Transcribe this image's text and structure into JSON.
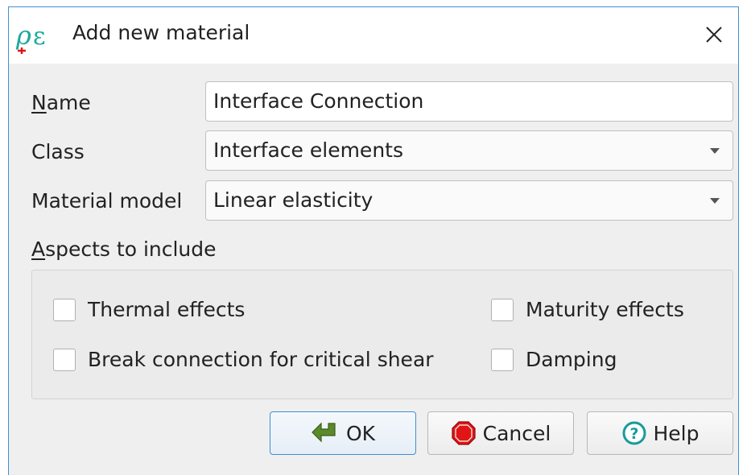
{
  "window": {
    "title": "Add new material",
    "app_icon": "oe-logo-icon",
    "close_icon": "close-icon"
  },
  "form": {
    "name": {
      "label_accel": "N",
      "label_rest": "ame",
      "value": "Interface Connection"
    },
    "class": {
      "label": "Class",
      "value": "Interface elements"
    },
    "material_model": {
      "label": "Material model",
      "value": "Linear elasticity"
    }
  },
  "aspects": {
    "label_accel": "A",
    "label_rest": "spects to include",
    "items": [
      {
        "label": "Thermal effects",
        "checked": false
      },
      {
        "label": "Maturity effects",
        "checked": false
      },
      {
        "label": "Break connection for critical shear",
        "checked": false
      },
      {
        "label": "Damping",
        "checked": false
      }
    ]
  },
  "buttons": {
    "ok": {
      "label": "OK",
      "icon": "green-arrow-icon"
    },
    "cancel": {
      "label": "Cancel",
      "icon": "red-stop-icon"
    },
    "help": {
      "label": "Help",
      "icon": "help-icon"
    }
  },
  "colors": {
    "accent": "#3f8fd3",
    "window_bg": "#efefef",
    "logo_teal": "#1aa89c",
    "stop_red": "#e01515",
    "ok_green": "#5a8a2a",
    "help_teal": "#1a9a9a"
  }
}
